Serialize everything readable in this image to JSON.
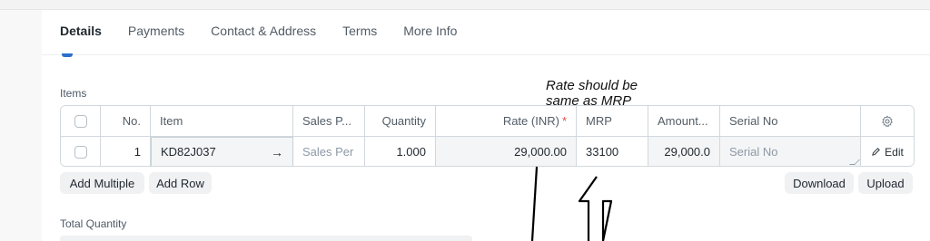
{
  "tabs": [
    "Details",
    "Payments",
    "Contact & Address",
    "Terms",
    "More Info"
  ],
  "items_section": {
    "label": "Items",
    "columns": {
      "no": "No.",
      "item": "Item",
      "sales_person": "Sales P...",
      "quantity": "Quantity",
      "rate": "Rate (INR)",
      "rate_required": "*",
      "mrp": "MRP",
      "amount": "Amount...",
      "serial_no": "Serial No"
    },
    "row": {
      "no": "1",
      "item": "KD82J037",
      "sales_person_placeholder": "Sales Per",
      "quantity": "1.000",
      "rate": "29,000.00",
      "mrp": "33100",
      "amount": "29,000.0",
      "serial_no_placeholder": "Serial No",
      "edit_label": "Edit"
    },
    "buttons": {
      "add_multiple": "Add Multiple",
      "add_row": "Add Row",
      "download": "Download",
      "upload": "Upload"
    }
  },
  "annotation": {
    "line1": "Rate should be",
    "line2": "same as MRP"
  },
  "total_quantity_label": "Total Quantity",
  "icons": {
    "settings": "gear-icon",
    "item_link": "arrow-right-icon",
    "edit": "pencil-icon"
  },
  "colors": {
    "accent": "#2c6ecb",
    "required": "#e24c4c",
    "border": "#d1d8dd"
  }
}
